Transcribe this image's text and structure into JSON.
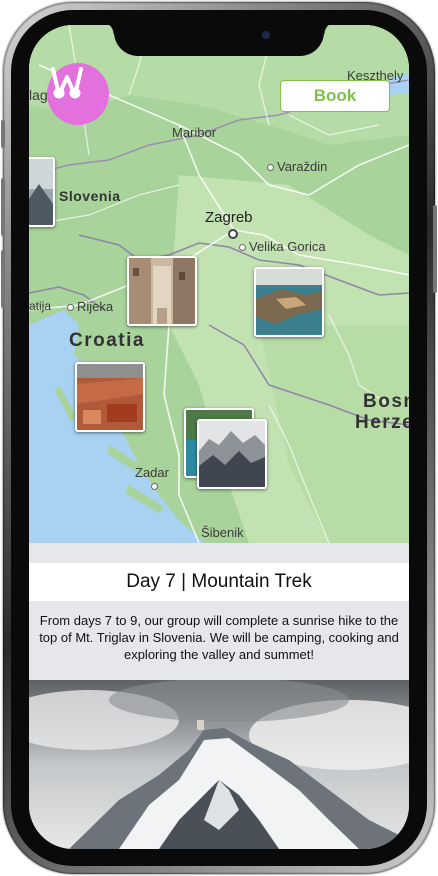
{
  "app": {
    "book_label": "Book",
    "logo_icon": "w-logo-icon",
    "accent": "#e271dd",
    "book_color": "#7ec049"
  },
  "map": {
    "labels": {
      "keszthely": "Keszthely",
      "maribor": "Maribor",
      "varazdin": "Varaždin",
      "slovenia": "Slovenia",
      "zagreb": "Zagreb",
      "velika_gorica": "Velika Gorica",
      "rijeka": "Rijeka",
      "atija": "atija",
      "croatia": "Croatia",
      "bosn": "Bosn",
      "herze": "Herze",
      "zadar": "Zadar",
      "sibenik": "Šibenik",
      "klag": "lag"
    }
  },
  "itinerary": {
    "title": "Day 7 | Mountain Trek",
    "description": "From days 7 to 9, our group will complete a sunrise hike to the top of Mt. Triglav in Slovenia. We will be camping, cooking and exploring the valley and summet!"
  }
}
